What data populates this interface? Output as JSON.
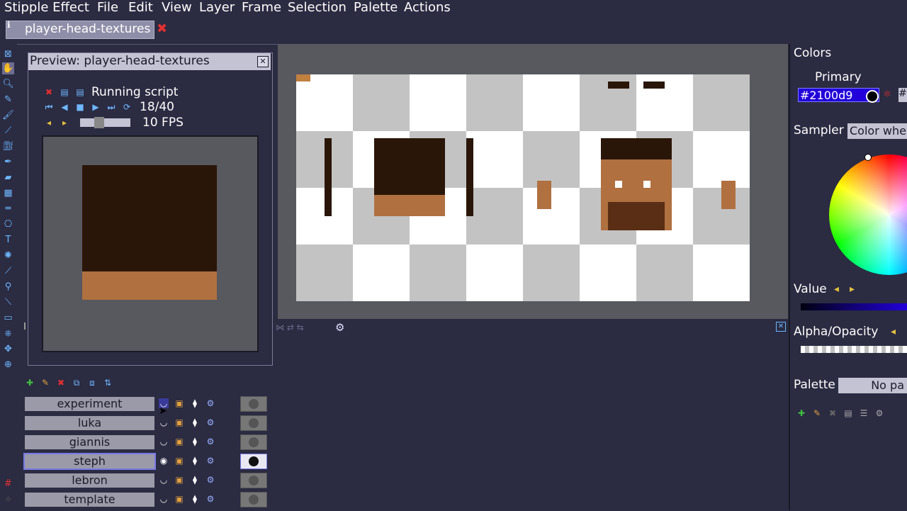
{
  "menu": {
    "app": "Stipple Effect",
    "items": [
      "File",
      "Edit",
      "View",
      "Layer",
      "Frame",
      "Selection",
      "Palette",
      "Actions"
    ]
  },
  "project_tab": {
    "label": "player-head-textures"
  },
  "preview": {
    "title": "Preview: player-head-textures",
    "status": "Running script",
    "frame_counter": "18/40",
    "fps": "10 FPS"
  },
  "layers": [
    {
      "name": "experiment"
    },
    {
      "name": "luka"
    },
    {
      "name": "giannis"
    },
    {
      "name": "steph",
      "selected": true
    },
    {
      "name": "lebron"
    },
    {
      "name": "template"
    }
  ],
  "colors_panel": {
    "title": "Colors",
    "primary_label": "Primary",
    "hex_value": "#2100d9",
    "sampler_label": "Sampler",
    "sampler_value": "Color whe",
    "value_label": "Value",
    "alpha_label": "Alpha/Opacity",
    "palette_label": "Palette",
    "palette_value": "No pa"
  },
  "colors": {
    "background": "#2b2b42",
    "accent": "#6fb7ff",
    "primary": "#2100d9",
    "close_red": "#e03030",
    "hair": "#2a1608",
    "skin": "#b07040"
  },
  "icons": {
    "toolbar": [
      "info-icon",
      "hand-icon",
      "zoom-icon",
      "pencil-icon",
      "brush-icon",
      "line-icon",
      "fill-icon",
      "picker-icon",
      "gradient-icon",
      "ruler-icon",
      "stamp-icon",
      "text-icon",
      "spray-icon",
      "wand-icon",
      "select-icon",
      "lasso-icon",
      "move-icon",
      "transform-icon"
    ]
  }
}
